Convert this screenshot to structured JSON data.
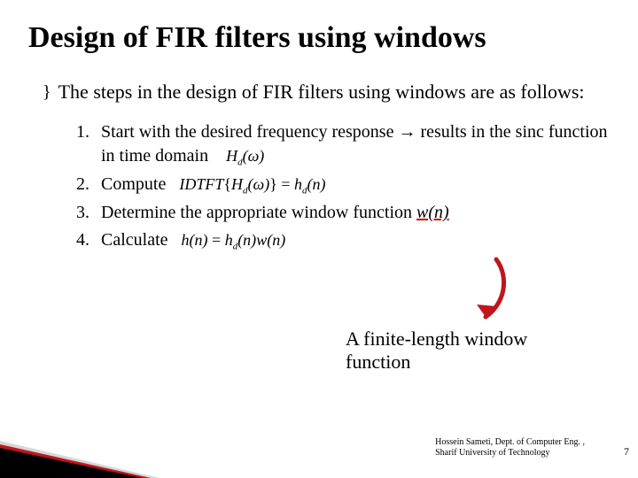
{
  "title": "Design of FIR filters using windows",
  "bullet_glyph": "}",
  "intro": "The steps in the design of FIR filters using windows are as follows:",
  "steps": {
    "s1": {
      "num": "1.",
      "text_a": "Start with  the desired frequency response ",
      "arrow": "→",
      "text_b": " results in the sinc function in time domain",
      "math": "H",
      "math_sub": "d",
      "math_arg": "(ω)"
    },
    "s2": {
      "num": "2.",
      "text": "Compute",
      "math_a": "IDTFT",
      "math_brace_open": "{",
      "math_H": "H",
      "math_H_sub": "d",
      "math_H_arg": "(ω)",
      "math_brace_close": "}",
      "math_eq": " = ",
      "math_h": "h",
      "math_h_sub": "d",
      "math_h_arg": "(n)"
    },
    "s3": {
      "num": "3.",
      "text": "Determine the appropriate window function ",
      "wn": "w(n)"
    },
    "s4": {
      "num": "4.",
      "text": "Calculate",
      "math_h": "h",
      "math_h_arg": "(n)",
      "math_eq": " = ",
      "math_hd": "h",
      "math_hd_sub": "d",
      "math_hd_arg": "(n)",
      "math_w": "w",
      "math_w_arg": "(n)"
    }
  },
  "annotation": "A finite-length window function",
  "footer_line1": "Hossein Sameti, Dept. of Computer Eng. ,",
  "footer_line2": "Sharif University of Technology",
  "page_number": "7"
}
